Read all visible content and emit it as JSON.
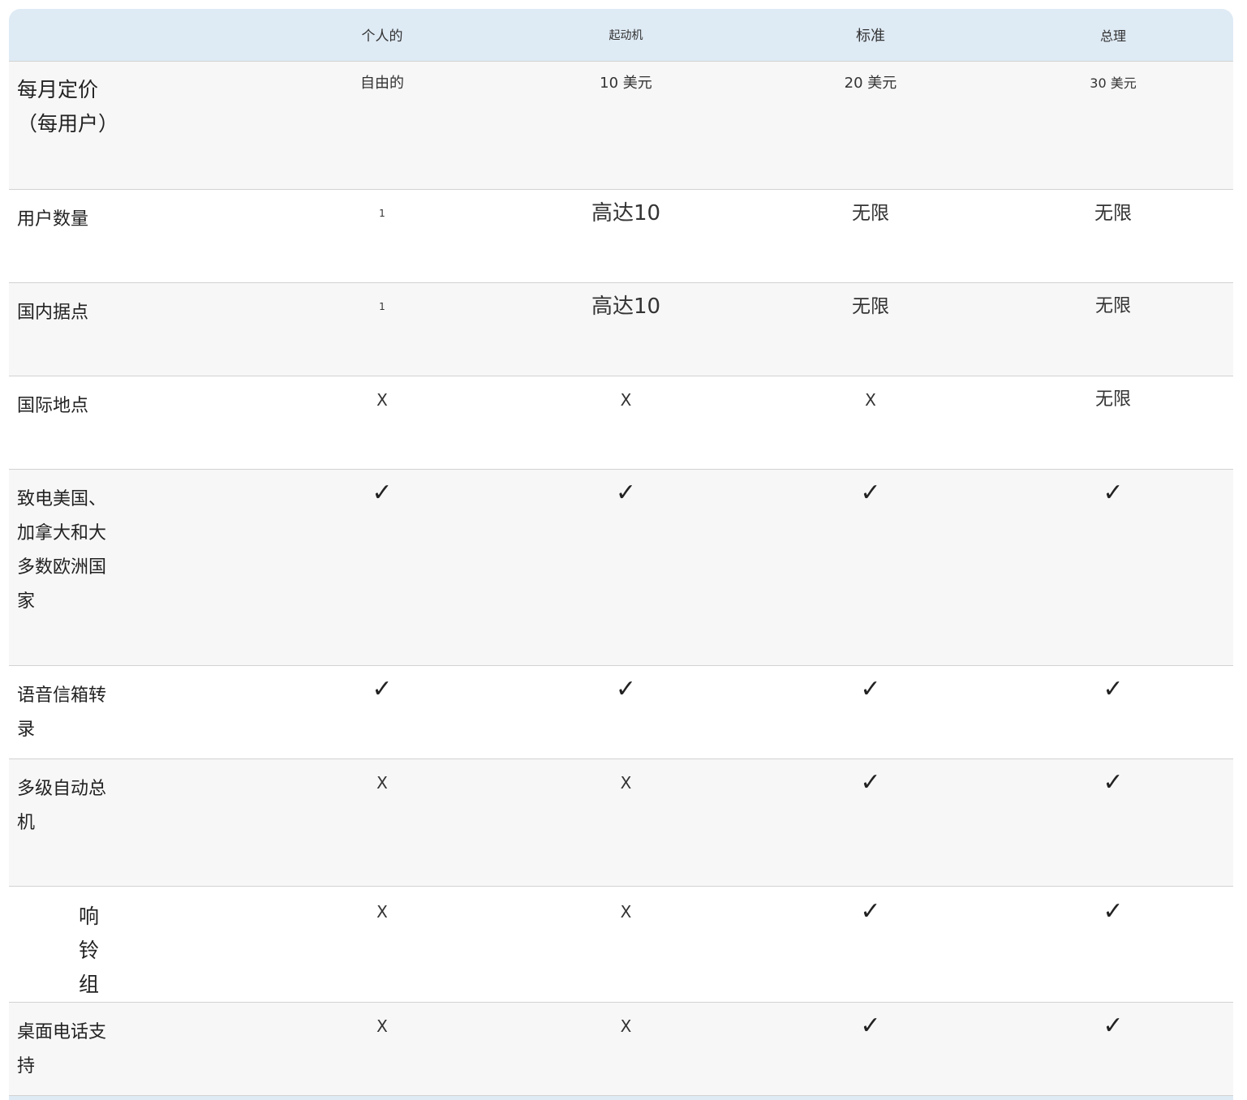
{
  "header": {
    "plans": [
      "个人的",
      "起动机",
      "标准",
      "总理"
    ]
  },
  "rows": [
    {
      "feature": "每月定价（每用户）",
      "values": [
        "自由的",
        "10 美元",
        "20 美元",
        "30 美元"
      ]
    },
    {
      "feature": "用户数量",
      "values": [
        "1",
        "高达10",
        "无限",
        "无限"
      ]
    },
    {
      "feature": "国内据点",
      "values": [
        "1",
        "高达10",
        "无限",
        "无限"
      ]
    },
    {
      "feature": "国际地点",
      "values": [
        "X",
        "X",
        "X",
        "无限"
      ]
    },
    {
      "feature": "致电美国、加拿大和大多数欧洲国家",
      "values": [
        "✓",
        "✓",
        "✓",
        "✓"
      ]
    },
    {
      "feature": "语音信箱转录",
      "values": [
        "✓",
        "✓",
        "✓",
        "✓"
      ]
    },
    {
      "feature": "多级自动总机",
      "values": [
        "X",
        "X",
        "✓",
        "✓"
      ]
    },
    {
      "feature": "响铃组",
      "values": [
        "X",
        "X",
        "✓",
        "✓"
      ]
    },
    {
      "feature": "桌面电话支持",
      "values": [
        "X",
        "X",
        "✓",
        "✓"
      ]
    }
  ]
}
